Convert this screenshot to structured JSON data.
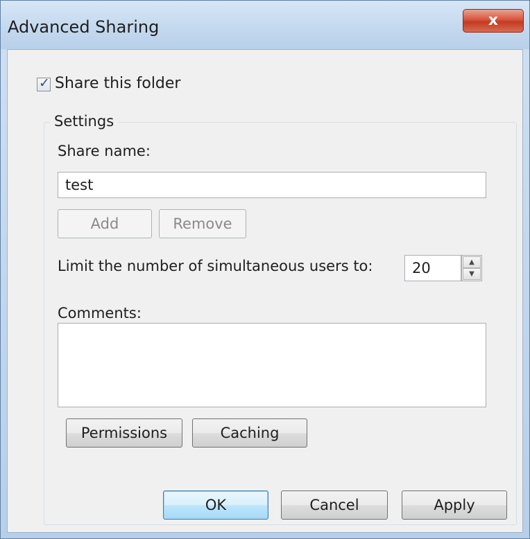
{
  "window": {
    "title": "Advanced Sharing",
    "close_icon": "close-icon",
    "close_glyph": "x"
  },
  "share_checkbox": {
    "label": "Share this folder",
    "checked": true,
    "mark": "✓"
  },
  "settings": {
    "legend": "Settings",
    "share_name_label": "Share name:",
    "share_name_value": "test",
    "add_label": "Add",
    "remove_label": "Remove",
    "limit_label": "Limit the number of simultaneous users to:",
    "limit_value": "20",
    "spin_up_glyph": "▲",
    "spin_down_glyph": "▼",
    "comments_label": "Comments:",
    "comments_value": "",
    "permissions_label": "Permissions",
    "caching_label": "Caching"
  },
  "footer": {
    "ok_label": "OK",
    "cancel_label": "Cancel",
    "apply_label": "Apply"
  },
  "colors": {
    "close_button": "#c23a22",
    "default_button_border": "#3c7fb1",
    "window_frame": "#b9d0ea"
  }
}
